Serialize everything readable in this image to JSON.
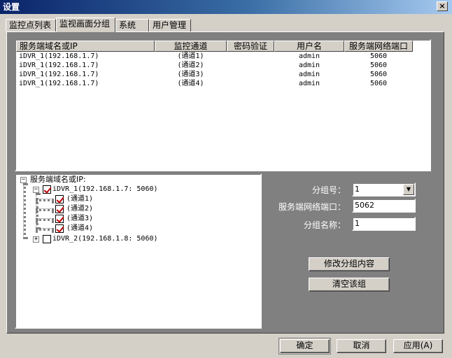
{
  "window": {
    "title": "设置",
    "close_label": "×"
  },
  "tabs": [
    {
      "label": "监控点列表"
    },
    {
      "label": "监视画面分组"
    },
    {
      "label": "系统"
    },
    {
      "label": "用户管理"
    }
  ],
  "list": {
    "columns": [
      "服务端域名或IP",
      "监控通道",
      "密码验证",
      "用户名",
      "服务端网络端口"
    ],
    "rows": [
      {
        "server": "iDVR_1(192.168.1.7)",
        "channel": "(通道1)",
        "password": "",
        "user": "admin",
        "port": "5060"
      },
      {
        "server": "iDVR_1(192.168.1.7)",
        "channel": "(通道2)",
        "password": "",
        "user": "admin",
        "port": "5060"
      },
      {
        "server": "iDVR_1(192.168.1.7)",
        "channel": "(通道3)",
        "password": "",
        "user": "admin",
        "port": "5060"
      },
      {
        "server": "iDVR_1(192.168.1.7)",
        "channel": "(通道4)",
        "password": "",
        "user": "admin",
        "port": "5060"
      }
    ]
  },
  "tree": {
    "root_label": "服务端域名或IP:",
    "root_expander": "−",
    "nodes": [
      {
        "label": "iDVR_1(192.168.1.7: 5060)",
        "checked": true,
        "expander": "−",
        "children": [
          {
            "label": "(通道1)",
            "checked": true
          },
          {
            "label": "(通道2)",
            "checked": true
          },
          {
            "label": "(通道3)",
            "checked": true
          },
          {
            "label": "(通道4)",
            "checked": true
          }
        ]
      },
      {
        "label": "iDVR_2(192.168.1.8: 5060)",
        "checked": false,
        "expander": "+"
      }
    ]
  },
  "form": {
    "group_no_label": "分组号：",
    "group_no_value": "1",
    "port_label": "服务端网络端口：",
    "port_value": "5062",
    "group_name_label": "分组名称：",
    "group_name_value": "1",
    "dropdown_arrow": "▼"
  },
  "buttons": {
    "modify": "修改分组内容",
    "clear": "清空该组",
    "ok": "确定",
    "cancel": "取消",
    "apply": "应用(A)"
  }
}
